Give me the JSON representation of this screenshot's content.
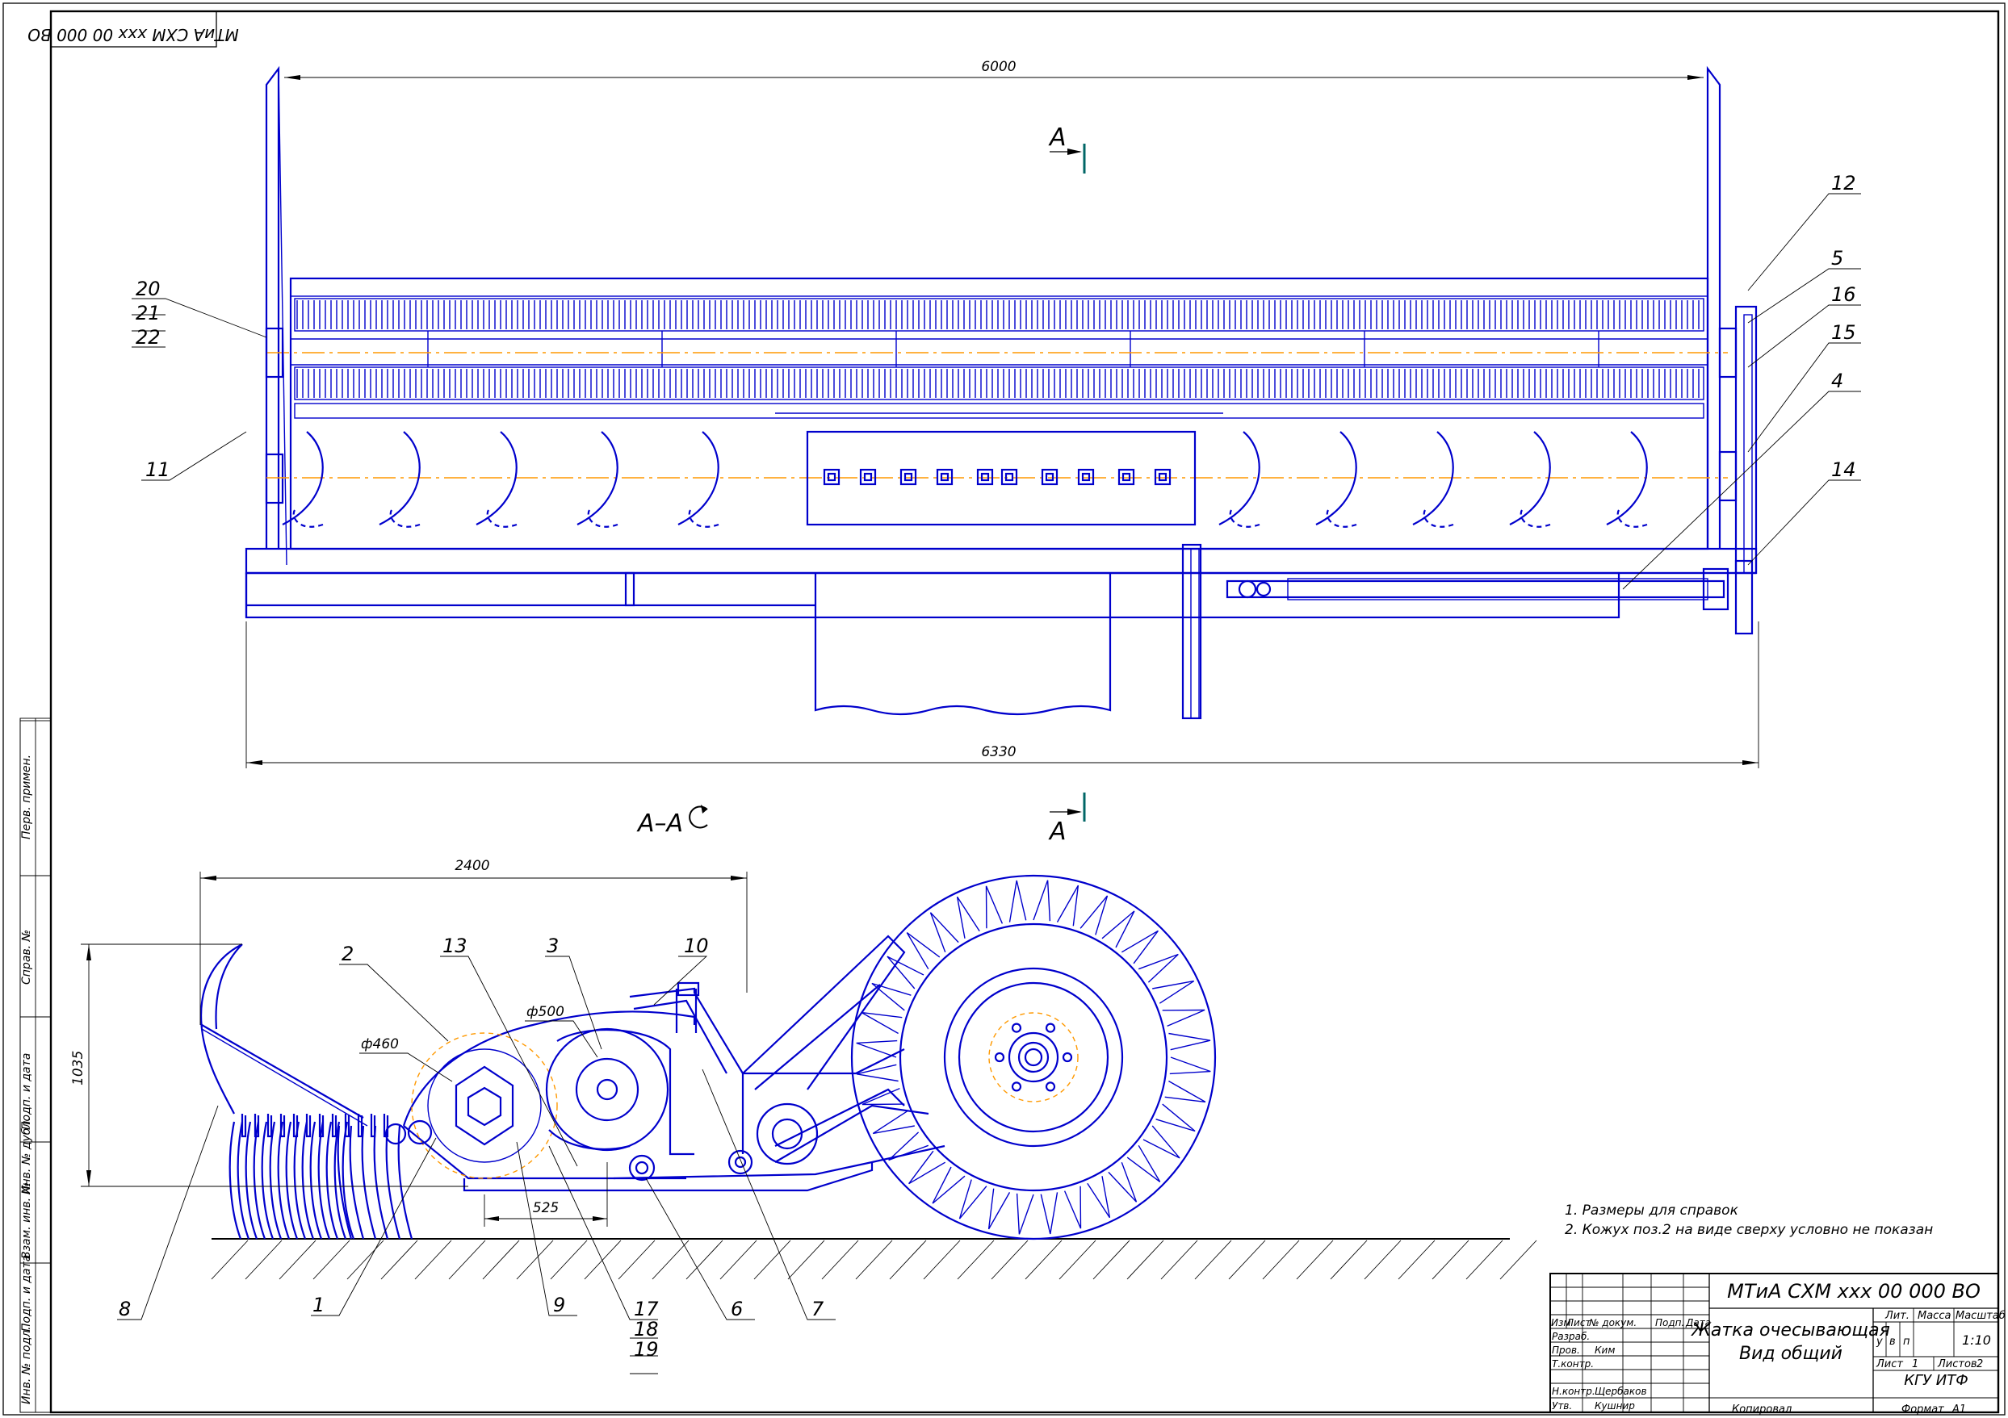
{
  "colors": {
    "line": "#0000cc",
    "dim": "#000000",
    "axis": "#ff9900",
    "section_mark": "#006666"
  },
  "stamp_rotated": "МТиА СХМ ххх 00 000 ВО",
  "dims": {
    "top_width": "6000",
    "bottom_width": "6330",
    "section_length": "2400",
    "height": "1035",
    "d460": "ф460",
    "d500": "ф500",
    "spacing": "525"
  },
  "section": {
    "label_top": "А",
    "label_bottom": "А",
    "title": "А–А"
  },
  "positions_top": {
    "p20": "20",
    "p21": "21",
    "p22": "22",
    "p11": "11",
    "p12": "12",
    "p5": "5",
    "p16": "16",
    "p15": "15",
    "p4": "4",
    "p14": "14"
  },
  "positions_side": {
    "p2": "2",
    "p13": "13",
    "p3": "3",
    "p10": "10",
    "p8": "8",
    "p1": "1",
    "p9": "9",
    "p17": "17",
    "p18": "18",
    "p19": "19",
    "p6": "6",
    "p7": "7"
  },
  "notes": [
    "1. Размеры для справок",
    "2. Кожух поз.2 на виде сверху условно не показан"
  ],
  "side_stamps": [
    "Перв. примен.",
    "Справ. №",
    "Подп. и дата",
    "Инв. № дубл.",
    "Взам. инв. №",
    "Подп. и дата",
    "Инв. № подл."
  ],
  "title_block": {
    "designation": "МТиА СХМ ххх 00 000 ВО",
    "name_line1": "Жатка очесывающая",
    "name_line2": "Вид общий",
    "head_izm": "Изм",
    "head_list": "Лист",
    "head_doc": "№ докум.",
    "head_podp": "Подп.",
    "head_date": "Дата",
    "role_razrab": "Разраб.",
    "role_prov": "Пров.",
    "role_tkontr": "Т.контр.",
    "role_nkontr": "Н.контр.",
    "role_utv": "Утв.",
    "name_prov": "Ким",
    "name_nkontr": "Щербаков",
    "name_utv": "Кушнир",
    "lit": "Лит.",
    "lit_u": "у",
    "lit_v": "в",
    "lit_p": "п",
    "mass": "Масса",
    "scale": "Масштаб",
    "scale_value": "1:10",
    "sheet": "Лист",
    "sheet_no": "1",
    "sheets": "Листов",
    "sheets_no": "2",
    "org": "КГУ ИТФ",
    "copied": "Копировал",
    "format": "Формат",
    "format_value": "А1"
  }
}
